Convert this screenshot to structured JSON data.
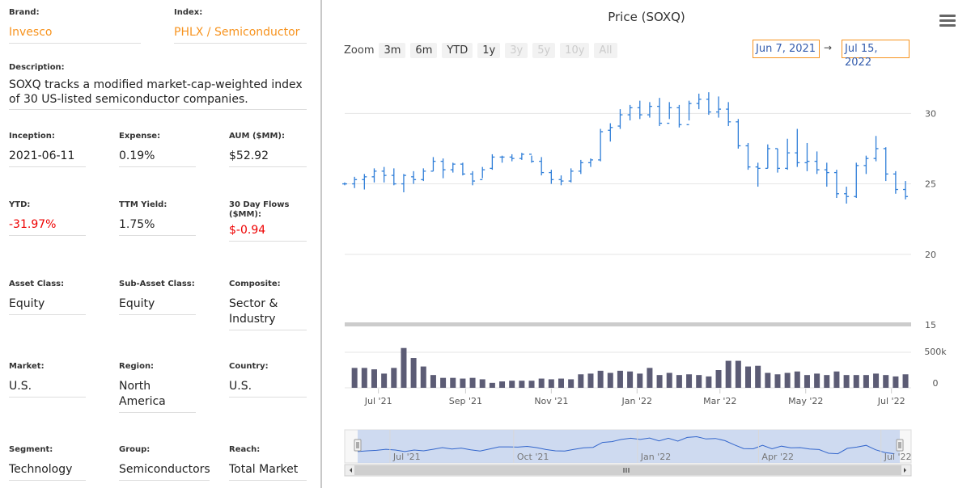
{
  "info": {
    "brand": {
      "label": "Brand:",
      "value": "Invesco"
    },
    "index": {
      "label": "Index:",
      "value": "PHLX / Semiconductor"
    },
    "description": {
      "label": "Description:",
      "value": "SOXQ tracks a modified market-cap-weighted index of 30 US-listed semiconductor companies."
    },
    "inception": {
      "label": "Inception:",
      "value": "2021-06-11"
    },
    "expense": {
      "label": "Expense:",
      "value": "0.19%"
    },
    "aum": {
      "label": "AUM ($MM):",
      "value": "$52.92"
    },
    "ytd": {
      "label": "YTD:",
      "value": "-31.97%"
    },
    "ttm_yield": {
      "label": "TTM Yield:",
      "value": "1.75%"
    },
    "flows": {
      "label": "30 Day Flows ($MM):",
      "value": "$-0.94"
    },
    "asset_class": {
      "label": "Asset Class:",
      "value": "Equity"
    },
    "sub_asset_class": {
      "label": "Sub-Asset Class:",
      "value": "Equity"
    },
    "composite": {
      "label": "Composite:",
      "value": "Sector & Industry"
    },
    "market": {
      "label": "Market:",
      "value": "U.S."
    },
    "region": {
      "label": "Region:",
      "value": "North America"
    },
    "country": {
      "label": "Country:",
      "value": "U.S."
    },
    "segment": {
      "label": "Segment:",
      "value": "Technology"
    },
    "group": {
      "label": "Group:",
      "value": "Semiconductors"
    },
    "reach": {
      "label": "Reach:",
      "value": "Total Market"
    }
  },
  "chart": {
    "title": "Price (SOXQ)",
    "zoom_label": "Zoom",
    "zoom_buttons": [
      {
        "label": "3m",
        "enabled": true
      },
      {
        "label": "6m",
        "enabled": true
      },
      {
        "label": "YTD",
        "enabled": true
      },
      {
        "label": "1y",
        "enabled": true
      },
      {
        "label": "3y",
        "enabled": false
      },
      {
        "label": "5y",
        "enabled": false
      },
      {
        "label": "10y",
        "enabled": false
      },
      {
        "label": "All",
        "enabled": false
      }
    ],
    "range_from": "Jun 7, 2021",
    "range_arrow": "→",
    "range_to": "Jul 15, 2022",
    "menu_icon": "hamburger-menu-icon",
    "colors": {
      "price": "#2f7ed8",
      "volume": "#5c5c75",
      "navigator_fill": "#c9d6ee",
      "navigator_line": "#3366cc",
      "accent": "#f7931e",
      "negative": "#ee0000"
    }
  },
  "chart_data": {
    "type": "ohlc",
    "price_axis": {
      "ticks": [
        15,
        20,
        25,
        30
      ],
      "ylim": [
        15,
        33
      ]
    },
    "volume_axis": {
      "ticks": [
        "0",
        "500k"
      ],
      "ylim": [
        0,
        500000
      ]
    },
    "x_ticks": [
      "Jul '21",
      "Sep '21",
      "Nov '21",
      "Jan '22",
      "Mar '22",
      "May '22",
      "Jul '22"
    ],
    "navigator_ticks": [
      "Jul '21",
      "Oct '21",
      "Jan '22",
      "Apr '22",
      "Jul '22"
    ],
    "weeks": [
      {
        "date": "2021-06-07",
        "open": 25.0,
        "high": 25.1,
        "low": 24.9,
        "close": 25.0,
        "volume": 0
      },
      {
        "date": "2021-06-14",
        "open": 25.0,
        "high": 25.5,
        "low": 24.7,
        "close": 25.3,
        "volume": 280000
      },
      {
        "date": "2021-06-21",
        "open": 25.3,
        "high": 25.7,
        "low": 24.6,
        "close": 25.5,
        "volume": 280000
      },
      {
        "date": "2021-06-28",
        "open": 25.5,
        "high": 26.1,
        "low": 25.1,
        "close": 25.9,
        "volume": 260000
      },
      {
        "date": "2021-07-05",
        "open": 25.9,
        "high": 26.2,
        "low": 25.1,
        "close": 25.6,
        "volume": 200000
      },
      {
        "date": "2021-07-12",
        "open": 25.6,
        "high": 26.1,
        "low": 24.9,
        "close": 25.0,
        "volume": 280000
      },
      {
        "date": "2021-07-19",
        "open": 25.0,
        "high": 25.7,
        "low": 24.4,
        "close": 25.6,
        "volume": 560000
      },
      {
        "date": "2021-07-26",
        "open": 25.5,
        "high": 25.9,
        "low": 25.0,
        "close": 25.3,
        "volume": 420000
      },
      {
        "date": "2021-08-02",
        "open": 25.3,
        "high": 26.1,
        "low": 25.2,
        "close": 25.9,
        "volume": 300000
      },
      {
        "date": "2021-08-09",
        "open": 25.9,
        "high": 26.9,
        "low": 25.9,
        "close": 26.6,
        "volume": 180000
      },
      {
        "date": "2021-08-16",
        "open": 26.6,
        "high": 26.8,
        "low": 25.4,
        "close": 26.0,
        "volume": 140000
      },
      {
        "date": "2021-08-23",
        "open": 26.0,
        "high": 26.5,
        "low": 25.8,
        "close": 26.4,
        "volume": 140000
      },
      {
        "date": "2021-08-30",
        "open": 26.4,
        "high": 26.5,
        "low": 25.6,
        "close": 25.7,
        "volume": 130000
      },
      {
        "date": "2021-09-06",
        "open": 25.7,
        "high": 25.9,
        "low": 24.9,
        "close": 25.2,
        "volume": 140000
      },
      {
        "date": "2021-09-13",
        "open": 25.3,
        "high": 26.2,
        "low": 25.4,
        "close": 26.0,
        "volume": 120000
      },
      {
        "date": "2021-09-20",
        "open": 26.1,
        "high": 27.1,
        "low": 26.0,
        "close": 26.9,
        "volume": 70000
      },
      {
        "date": "2021-09-27",
        "open": 26.9,
        "high": 27.0,
        "low": 26.5,
        "close": 26.9,
        "volume": 90000
      },
      {
        "date": "2021-10-04",
        "open": 26.9,
        "high": 27.1,
        "low": 26.6,
        "close": 26.8,
        "volume": 100000
      },
      {
        "date": "2021-10-11",
        "open": 26.8,
        "high": 27.2,
        "low": 26.7,
        "close": 27.1,
        "volume": 100000
      },
      {
        "date": "2021-10-18",
        "open": 27.1,
        "high": 27.0,
        "low": 26.5,
        "close": 26.6,
        "volume": 100000
      },
      {
        "date": "2021-10-25",
        "open": 26.6,
        "high": 26.9,
        "low": 25.6,
        "close": 25.8,
        "volume": 130000
      },
      {
        "date": "2021-11-01",
        "open": 25.8,
        "high": 26.0,
        "low": 25.0,
        "close": 25.3,
        "volume": 120000
      },
      {
        "date": "2021-11-08",
        "open": 25.3,
        "high": 25.6,
        "low": 24.9,
        "close": 25.2,
        "volume": 130000
      },
      {
        "date": "2021-11-15",
        "open": 25.2,
        "high": 26.1,
        "low": 25.1,
        "close": 25.9,
        "volume": 120000
      },
      {
        "date": "2021-11-22",
        "open": 25.9,
        "high": 26.7,
        "low": 25.7,
        "close": 26.5,
        "volume": 190000
      },
      {
        "date": "2021-11-29",
        "open": 26.5,
        "high": 26.8,
        "low": 26.2,
        "close": 26.7,
        "volume": 200000
      },
      {
        "date": "2021-12-06",
        "open": 26.7,
        "high": 28.9,
        "low": 26.6,
        "close": 28.7,
        "volume": 240000
      },
      {
        "date": "2021-12-13",
        "open": 28.8,
        "high": 29.3,
        "low": 28.0,
        "close": 29.0,
        "volume": 210000
      },
      {
        "date": "2021-12-20",
        "open": 29.1,
        "high": 30.3,
        "low": 28.9,
        "close": 29.9,
        "volume": 240000
      },
      {
        "date": "2021-12-27",
        "open": 29.9,
        "high": 30.6,
        "low": 29.5,
        "close": 30.4,
        "volume": 230000
      },
      {
        "date": "2022-01-03",
        "open": 30.4,
        "high": 30.9,
        "low": 29.6,
        "close": 29.9,
        "volume": 200000
      },
      {
        "date": "2022-01-10",
        "open": 29.9,
        "high": 30.8,
        "low": 29.7,
        "close": 30.5,
        "volume": 280000
      },
      {
        "date": "2022-01-17",
        "open": 30.5,
        "high": 31.1,
        "low": 29.1,
        "close": 29.3,
        "volume": 180000
      },
      {
        "date": "2022-01-24",
        "open": 29.3,
        "high": 30.8,
        "low": 29.6,
        "close": 30.4,
        "volume": 210000
      },
      {
        "date": "2022-01-31",
        "open": 30.4,
        "high": 30.6,
        "low": 29.0,
        "close": 29.2,
        "volume": 180000
      },
      {
        "date": "2022-02-07",
        "open": 29.2,
        "high": 30.9,
        "low": 29.5,
        "close": 30.7,
        "volume": 190000
      },
      {
        "date": "2022-02-14",
        "open": 30.7,
        "high": 31.4,
        "low": 30.3,
        "close": 31.0,
        "volume": 180000
      },
      {
        "date": "2022-02-21",
        "open": 31.0,
        "high": 31.5,
        "low": 29.9,
        "close": 30.1,
        "volume": 160000
      },
      {
        "date": "2022-02-28",
        "open": 30.1,
        "high": 31.2,
        "low": 29.7,
        "close": 30.3,
        "volume": 250000
      },
      {
        "date": "2022-03-07",
        "open": 30.3,
        "high": 30.8,
        "low": 29.1,
        "close": 29.4,
        "volume": 380000
      },
      {
        "date": "2022-03-14",
        "open": 29.4,
        "high": 29.6,
        "low": 27.5,
        "close": 27.7,
        "volume": 380000
      },
      {
        "date": "2022-03-21",
        "open": 27.7,
        "high": 27.9,
        "low": 26.0,
        "close": 26.2,
        "volume": 300000
      },
      {
        "date": "2022-03-28",
        "open": 26.2,
        "high": 26.5,
        "low": 24.8,
        "close": 26.1,
        "volume": 310000
      },
      {
        "date": "2022-04-04",
        "open": 26.1,
        "high": 27.8,
        "low": 26.1,
        "close": 27.5,
        "volume": 210000
      },
      {
        "date": "2022-04-11",
        "open": 27.5,
        "high": 27.5,
        "low": 25.8,
        "close": 26.1,
        "volume": 190000
      },
      {
        "date": "2022-04-18",
        "open": 26.1,
        "high": 28.2,
        "low": 26.0,
        "close": 27.2,
        "volume": 210000
      },
      {
        "date": "2022-04-25",
        "open": 27.2,
        "high": 28.9,
        "low": 26.2,
        "close": 26.5,
        "volume": 230000
      },
      {
        "date": "2022-05-02",
        "open": 26.5,
        "high": 27.9,
        "low": 25.9,
        "close": 26.6,
        "volume": 180000
      },
      {
        "date": "2022-05-09",
        "open": 26.6,
        "high": 27.3,
        "low": 25.7,
        "close": 26.0,
        "volume": 200000
      },
      {
        "date": "2022-05-16",
        "open": 26.0,
        "high": 26.5,
        "low": 24.8,
        "close": 25.8,
        "volume": 180000
      },
      {
        "date": "2022-05-23",
        "open": 25.8,
        "high": 26.0,
        "low": 24.0,
        "close": 24.3,
        "volume": 230000
      },
      {
        "date": "2022-05-30",
        "open": 24.3,
        "high": 24.8,
        "low": 23.6,
        "close": 24.1,
        "volume": 180000
      },
      {
        "date": "2022-06-06",
        "open": 24.1,
        "high": 26.5,
        "low": 24.0,
        "close": 26.3,
        "volume": 180000
      },
      {
        "date": "2022-06-13",
        "open": 26.3,
        "high": 27.0,
        "low": 25.7,
        "close": 26.8,
        "volume": 180000
      },
      {
        "date": "2022-06-20",
        "open": 26.8,
        "high": 28.4,
        "low": 26.6,
        "close": 27.5,
        "volume": 200000
      },
      {
        "date": "2022-06-27",
        "open": 27.5,
        "high": 27.6,
        "low": 25.2,
        "close": 25.7,
        "volume": 180000
      },
      {
        "date": "2022-07-04",
        "open": 25.7,
        "high": 25.9,
        "low": 24.3,
        "close": 24.6,
        "volume": 160000
      },
      {
        "date": "2022-07-11",
        "open": 24.6,
        "high": 25.2,
        "low": 23.9,
        "close": 24.1,
        "volume": 190000
      }
    ]
  }
}
